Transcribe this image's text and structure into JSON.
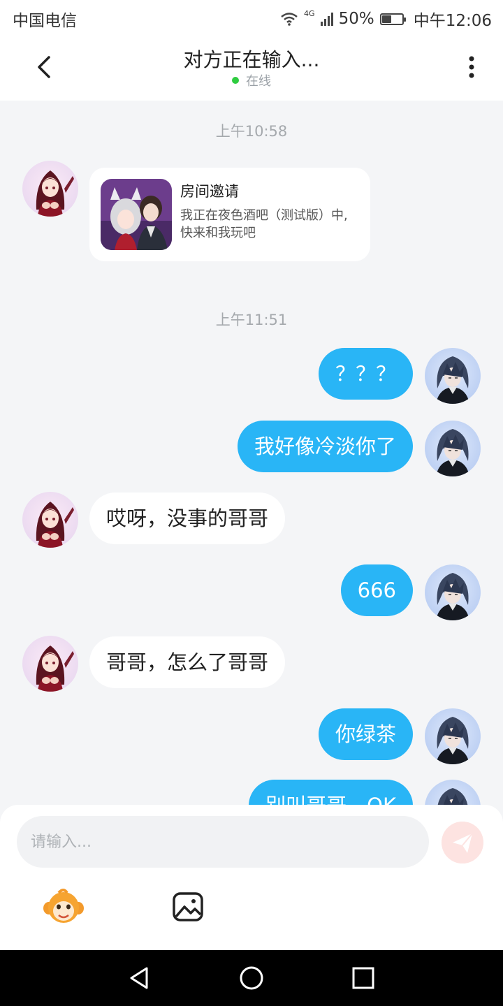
{
  "status_bar": {
    "carrier": "中国电信",
    "network": "4G",
    "battery": "50%",
    "time": "中午12:06"
  },
  "header": {
    "title": "对方正在输入...",
    "status": "在线"
  },
  "messages": [
    {
      "type": "time",
      "text": "上午10:58"
    },
    {
      "type": "invite",
      "sender": "them",
      "title": "房间邀请",
      "description": "我正在夜色酒吧（测试版）中, 快来和我玩吧"
    },
    {
      "type": "time",
      "text": "上午11:51"
    },
    {
      "type": "text",
      "sender": "me",
      "text": "？？？"
    },
    {
      "type": "text",
      "sender": "me",
      "text": "我好像冷淡你了"
    },
    {
      "type": "text",
      "sender": "them",
      "text": "哎呀，没事的哥哥"
    },
    {
      "type": "text",
      "sender": "me",
      "text": "666"
    },
    {
      "type": "text",
      "sender": "them",
      "text": "哥哥，怎么了哥哥"
    },
    {
      "type": "text",
      "sender": "me",
      "text": "你绿茶"
    },
    {
      "type": "text",
      "sender": "me",
      "text": "别叫哥哥，OK"
    }
  ],
  "composer": {
    "placeholder": "请输入..."
  },
  "icons": {
    "back": "chevron-left-icon",
    "more": "more-vertical-icon",
    "send": "send-icon",
    "emoji": "monkey-emoji-icon",
    "image": "image-icon",
    "nav_back": "triangle-back-icon",
    "nav_home": "circle-home-icon",
    "nav_recent": "square-recent-icon"
  },
  "colors": {
    "my_bubble": "#29b5f6",
    "their_bubble": "#ffffff",
    "chat_bg": "#f4f5f7",
    "online": "#2ecc40",
    "send_button": "#fde3e1"
  }
}
